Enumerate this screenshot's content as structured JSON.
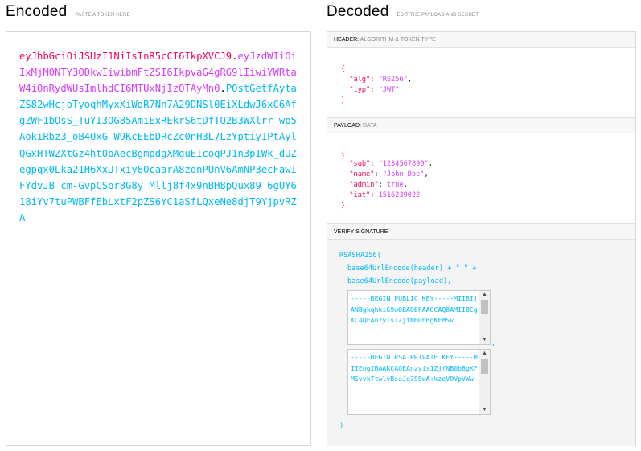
{
  "encoded": {
    "title": "Encoded",
    "subtitle": "PASTE A TOKEN HERE",
    "token_header": "eyJhbGciOiJSUzI1NiIsInR5cCI6IkpXVCJ9",
    "dot1": ".",
    "token_payload": "eyJzdWIiOiIxMjM0NTY3ODkwIiwibmFtZSI6IkpvaG4gRG9lIiwiYWRtaW4iOnRydWUsImlhdCI6MTUxNjIzOTAyMn0",
    "dot2": ".",
    "token_signature": "POstGetfAytaZS82wHcjoTyoqhMyxXiWdR7Nn7A29DNSl0EiXLdwJ6xC6AfgZWF1bOsS_TuYI3OG85AmiExREkrS6tDfTQ2B3WXlrr-wp5AokiRbz3_oB4OxG-W9KcEEbDRcZc0nH3L7LzYptiy1PtAylQGxHTWZXtGz4ht0bAecBgmpdgXMguEIcoqPJ1n3pIWk_dUZegpqx0Lka21H6XxUTxiy8OcaarA8zdnPUnV6AmNP3ecFawIFYdvJB_cm-GvpCSbr8G8y_Mllj8f4x9nBH8pQux89_6gUY618iYv7tuPWBFfEbLxtF2pZS6YC1aSfLQxeNe8djT9YjpvRZA"
  },
  "decoded": {
    "title": "Decoded",
    "subtitle": "EDIT THE PAYLOAD AND SECRET",
    "header_section": {
      "label": "HEADER:",
      "sublabel": "ALGORITHM & TOKEN TYPE",
      "open": "{",
      "close": "}",
      "alg_key": "\"alg\"",
      "alg_val": "\"RS256\"",
      "typ_key": "\"typ\"",
      "typ_val": "\"JWT\""
    },
    "payload_section": {
      "label": "PAYLOAD:",
      "sublabel": "DATA",
      "open": "{",
      "close": "}",
      "sub_key": "\"sub\"",
      "sub_val": "\"1234567890\"",
      "name_key": "\"name\"",
      "name_val": "\"John Doe\"",
      "admin_key": "\"admin\"",
      "admin_val": "true",
      "iat_key": "\"iat\"",
      "iat_val": "1516239022"
    },
    "signature_section": {
      "label": "VERIFY SIGNATURE",
      "line1": "RSASHA256(",
      "line2": "base64UrlEncode(header) + \".\" +",
      "line3": "base64UrlEncode(payload),",
      "public_key": "-----BEGIN PUBLIC KEY-----MIIBIjANBgkqhkiG9w0BAQEFAAOCAQ8AMIIBCgKCAQEAnzyis1ZjfNB0bBgKFMSv",
      "private_key": "-----BEGIN RSA PRIVATE KEY-----MIIEogIBAAKCAQEAnzyis1ZjfNB0bBgKFMSvvkTtwlvBsaJq7S5wA+kzeVOVpVWw",
      "comma": ",",
      "close": ")",
      "public_scroll_position": 0.0,
      "private_scroll_position": 0.0
    }
  },
  "colors": {
    "header": "#fb015b",
    "payload": "#d63aff",
    "signature": "#00b9f1"
  }
}
